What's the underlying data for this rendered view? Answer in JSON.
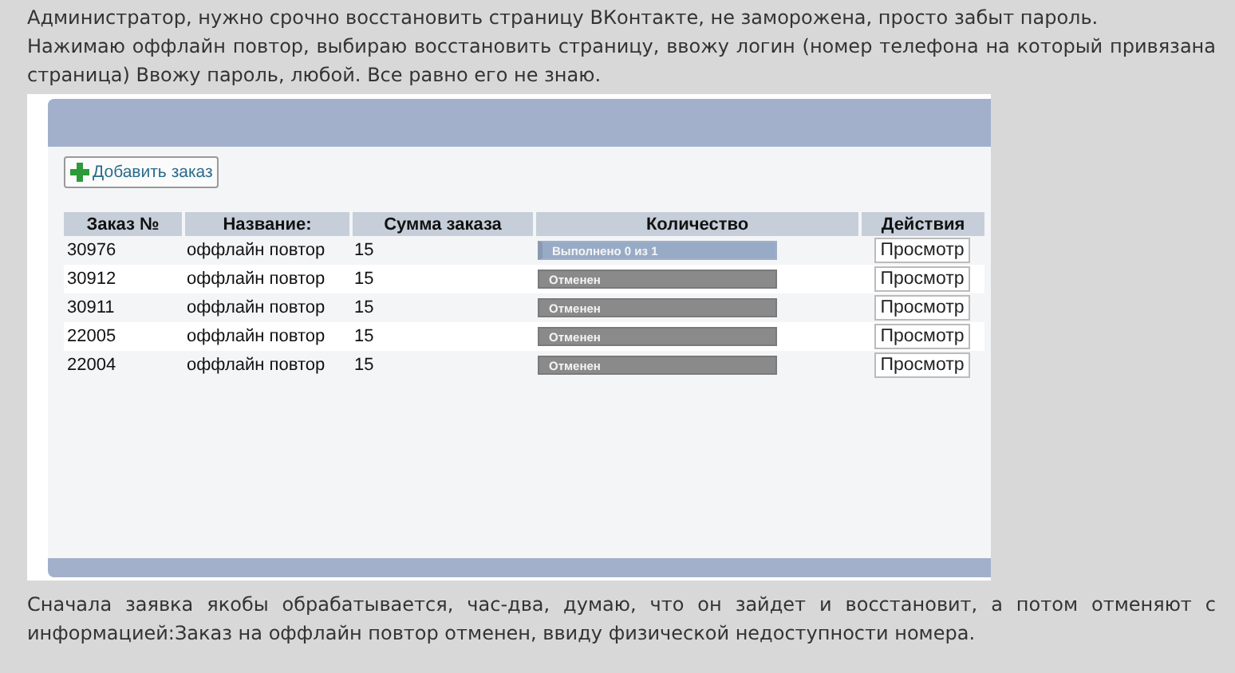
{
  "post_paragraphs": [
    "Администратор, нужно срочно восстановить страницу ВКонтакте, не заморожена, просто забыт пароль.",
    "Нажимаю оффлайн повтор, выбираю восстановить страницу, ввожу логин (номер телефона на который привязана страница) Ввожу пароль, любой. Все равно его не знаю."
  ],
  "screenshot": {
    "add_button": "Добавить заказ",
    "table": {
      "columns": [
        "Заказ №",
        "Название:",
        "Сумма заказа",
        "Количество",
        "Действия"
      ],
      "rows": [
        {
          "order": "30976",
          "name": "оффлайн повтор",
          "sum": "15",
          "status": {
            "kind": "progress",
            "text": "Выполнено 0 из 1",
            "level": 0
          },
          "action": "Просмотр"
        },
        {
          "order": "30912",
          "name": "оффлайн повтор",
          "sum": "15",
          "status": {
            "kind": "cancelled",
            "text": "Отменен"
          },
          "action": "Просмотр"
        },
        {
          "order": "30911",
          "name": "оффлайн повтор",
          "sum": "15",
          "status": {
            "kind": "cancelled",
            "text": "Отменен"
          },
          "action": "Просмотр"
        },
        {
          "order": "22005",
          "name": "оффлайн повтор",
          "sum": "15",
          "status": {
            "kind": "cancelled",
            "text": "Отменен"
          },
          "action": "Просмотр"
        },
        {
          "order": "22004",
          "name": "оффлайн повтор",
          "sum": "15",
          "status": {
            "kind": "cancelled",
            "text": "Отменен"
          },
          "action": "Просмотр"
        }
      ]
    }
  },
  "post_after": "Сначала заявка якобы обрабатывается, час-два, думаю, что он зайдет и восстановит, а потом отменяют с информацией:Заказ на оффлайн повтор отменен, ввиду физической недоступности номера."
}
